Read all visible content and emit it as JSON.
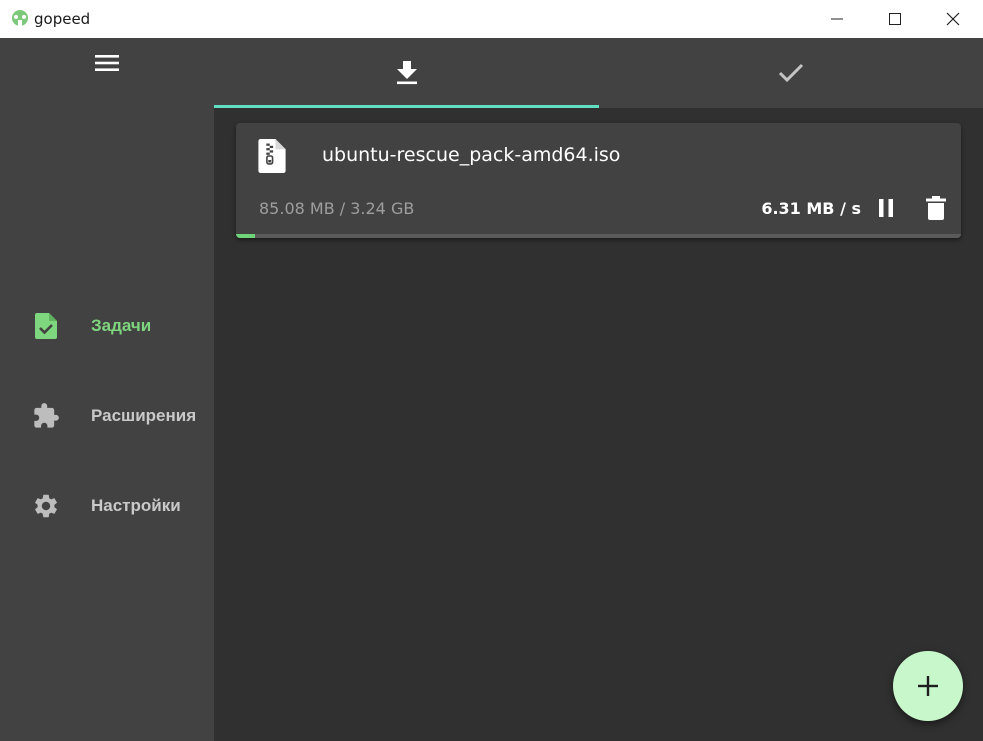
{
  "window": {
    "title": "gopeed",
    "controls": [
      "minimize-icon",
      "maximize-icon",
      "close-icon"
    ]
  },
  "sidebar": {
    "menu_icon": "hamburger-icon",
    "items": [
      {
        "label": "Задачи",
        "icon": "file-check-icon",
        "active": true
      },
      {
        "label": "Расширения",
        "icon": "puzzle-icon",
        "active": false
      },
      {
        "label": "Настройки",
        "icon": "gear-icon",
        "active": false
      }
    ]
  },
  "tabs": [
    {
      "icon": "download-icon",
      "active": true
    },
    {
      "icon": "check-icon",
      "active": false
    }
  ],
  "tasks": [
    {
      "name": "ubuntu-rescue_pack-amd64.iso",
      "size": "85.08 MB / 3.24 GB",
      "speed": "6.31 MB / s",
      "progress": 0.026,
      "file_icon": "zip-file-icon",
      "actions": [
        "pause-icon",
        "delete-icon"
      ]
    }
  ],
  "fab_icon": "plus-icon",
  "colors": {
    "accent_green": "#7ed67e",
    "tab_indicator": "#62dfc0",
    "fab": "#c9f7cc",
    "sidebar_bg": "#424242",
    "main_bg": "#303030"
  }
}
